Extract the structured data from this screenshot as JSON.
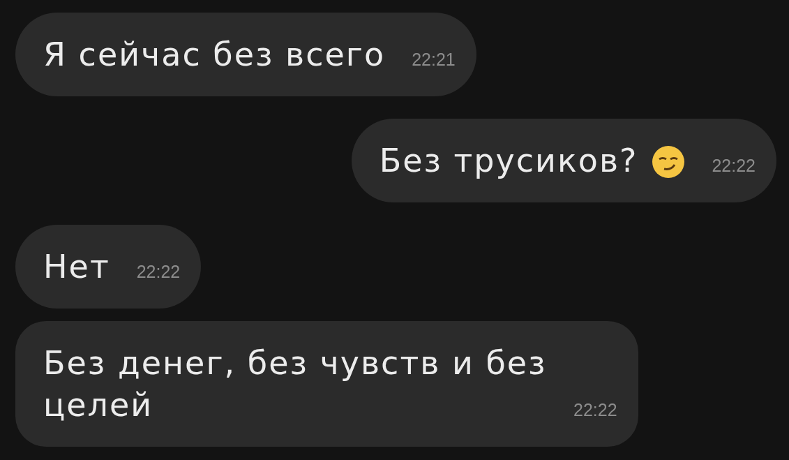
{
  "messages": [
    {
      "outgoing": false,
      "text": "Я сейчас без всего",
      "emoji": false,
      "time": "22:21"
    },
    {
      "outgoing": true,
      "text": "Без трусиков?",
      "emoji": true,
      "time": "22:22"
    },
    {
      "outgoing": false,
      "text": "Нет",
      "emoji": false,
      "time": "22:22"
    },
    {
      "outgoing": false,
      "text": "Без денег, без чувств и без целей",
      "emoji": false,
      "time": "22:22"
    }
  ]
}
